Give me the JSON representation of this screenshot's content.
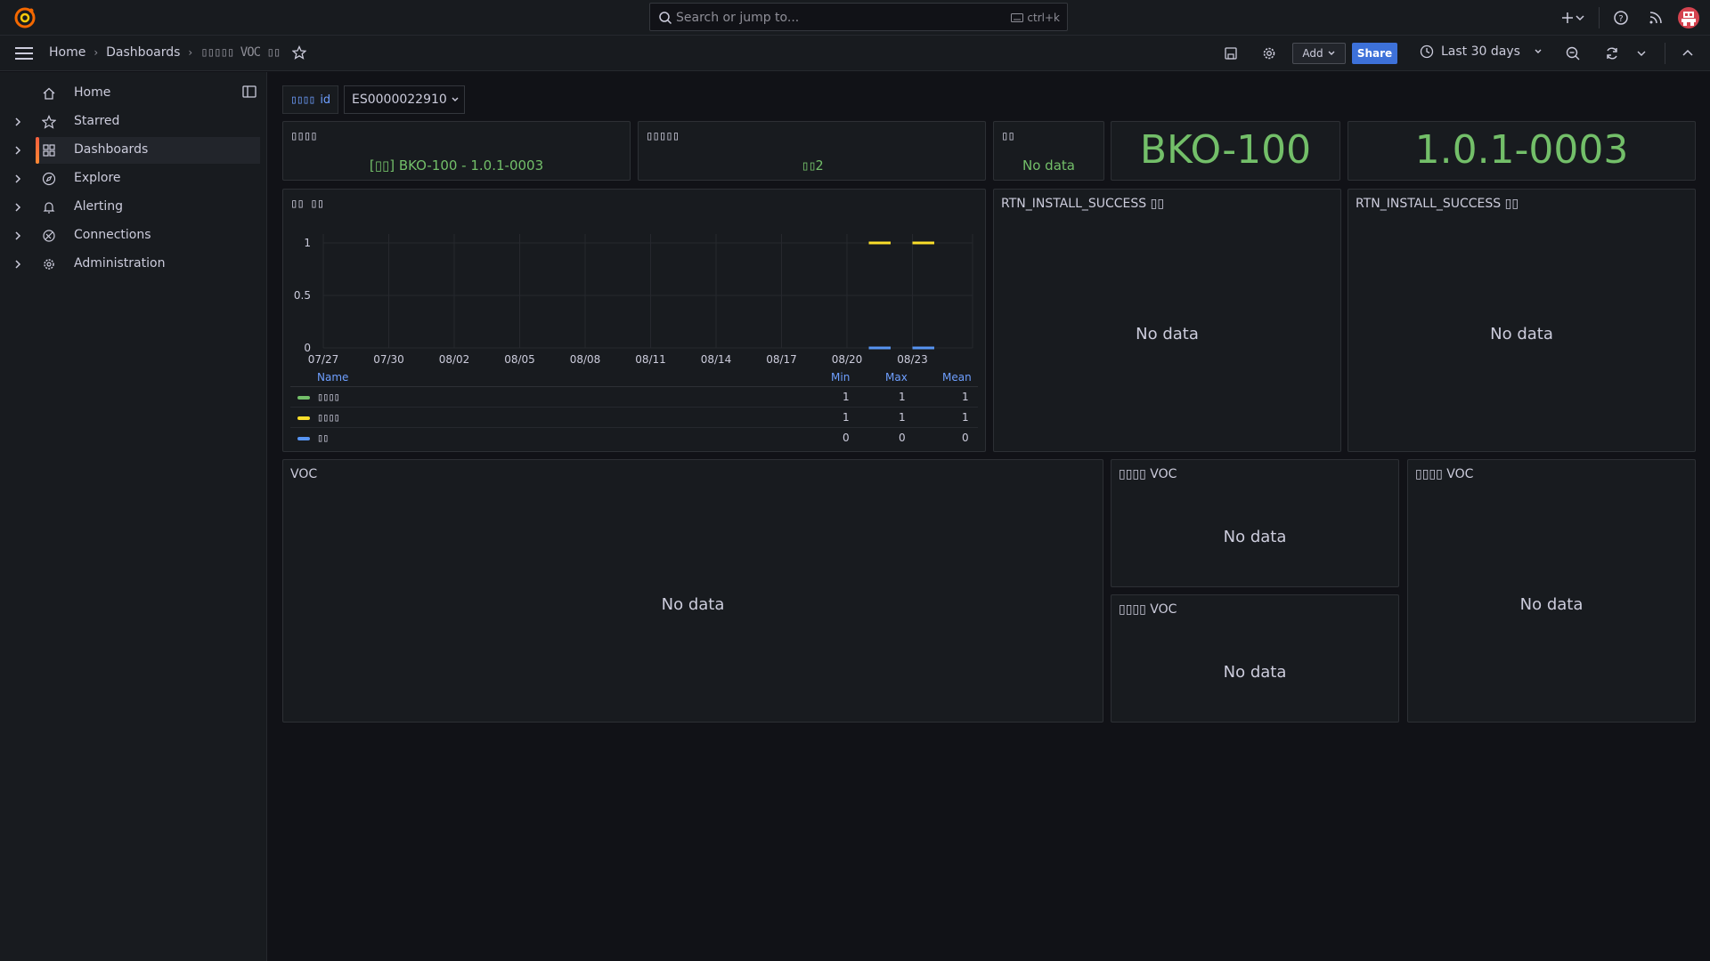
{
  "topbar": {
    "search_placeholder": "Search or jump to...",
    "search_shortcut": "ctrl+k"
  },
  "breadcrumb": {
    "home": "Home",
    "dashboards": "Dashboards",
    "current": "▯▯▯▯▯ VOC ▯▯"
  },
  "toolbar": {
    "add_label": "Add",
    "share_label": "Share",
    "time_range": "Last 30 days"
  },
  "sidebar": {
    "items": [
      {
        "label": "Home",
        "icon": "home-icon"
      },
      {
        "label": "Starred",
        "icon": "star-icon"
      },
      {
        "label": "Dashboards",
        "icon": "apps-icon"
      },
      {
        "label": "Explore",
        "icon": "compass-icon"
      },
      {
        "label": "Alerting",
        "icon": "bell-icon"
      },
      {
        "label": "Connections",
        "icon": "plug-icon"
      },
      {
        "label": "Administration",
        "icon": "cog-icon"
      }
    ]
  },
  "variable": {
    "label_prefix": "▯▯▯▯",
    "label_suffix": "id",
    "value": "ES0000022910"
  },
  "panels": {
    "p1": {
      "title": "▯▯▯▯",
      "value": "[▯▯] BKO-100 - 1.0.1-0003"
    },
    "p2": {
      "title": "▯▯▯▯▯",
      "value": "▯▯2"
    },
    "p3": {
      "title": "▯▯",
      "value": "No data"
    },
    "p4": {
      "value": "BKO-100"
    },
    "p5": {
      "value": "1.0.1-0003"
    },
    "chart": {
      "title": "▯▯ ▯▯"
    },
    "rtn1": {
      "title": "RTN_INSTALL_SUCCESS ▯▯",
      "value": "No data"
    },
    "rtn2": {
      "title": "RTN_INSTALL_SUCCESS ▯▯",
      "value": "No data"
    },
    "voc": {
      "title": "VOC",
      "value": "No data"
    },
    "voc2": {
      "title": "▯▯▯▯ VOC",
      "value": "No data"
    },
    "voc3": {
      "title": "▯▯▯▯ VOC",
      "value": "No data"
    },
    "voc4": {
      "title": "▯▯▯▯ VOC",
      "value": "No data"
    }
  },
  "legend": {
    "headers": {
      "name": "Name",
      "min": "Min",
      "max": "Max",
      "mean": "Mean"
    },
    "rows": [
      {
        "name": "▯▯▯▯",
        "color": "#73bf69",
        "min": "1",
        "max": "1",
        "mean": "1"
      },
      {
        "name": "▯▯▯▯",
        "color": "#fade2a",
        "min": "1",
        "max": "1",
        "mean": "1"
      },
      {
        "name": "▯▯",
        "color": "#5794f2",
        "min": "0",
        "max": "0",
        "mean": "0"
      }
    ]
  },
  "chart_data": {
    "type": "line",
    "x_ticks": [
      "07/27",
      "07/30",
      "08/02",
      "08/05",
      "08/08",
      "08/11",
      "08/14",
      "08/17",
      "08/20",
      "08/23"
    ],
    "y_ticks": [
      "0",
      "0.5",
      "1"
    ],
    "ylim": [
      0,
      1
    ],
    "series": [
      {
        "name": "▯▯▯▯",
        "color": "#73bf69",
        "segments": []
      },
      {
        "name": "▯▯▯▯",
        "color": "#fade2a",
        "segments": [
          {
            "x": [
              "08/21",
              "08/22"
            ],
            "y": 1
          },
          {
            "x": [
              "08/23",
              "08/24"
            ],
            "y": 1
          }
        ]
      },
      {
        "name": "▯▯",
        "color": "#5794f2",
        "segments": [
          {
            "x": [
              "08/21",
              "08/22"
            ],
            "y": 0
          },
          {
            "x": [
              "08/23",
              "08/24"
            ],
            "y": 0
          }
        ]
      }
    ]
  }
}
